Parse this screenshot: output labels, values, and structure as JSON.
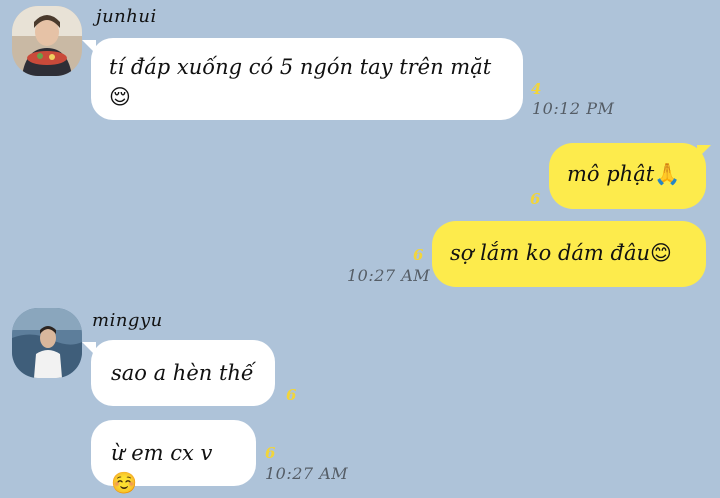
{
  "messages": [
    {
      "sender": "junhui",
      "text": "tí đáp xuống có 5 ngón tay trên mặt",
      "emoji": "😌",
      "unread": "4",
      "time": "10:12 PM"
    },
    {
      "sender": "me",
      "text": "mô phật",
      "emoji": "🙏",
      "unread": "6"
    },
    {
      "sender": "me",
      "text": "sợ lắm ko dám đâu",
      "emoji": "😊",
      "unread": "6",
      "time": "10:27 AM"
    },
    {
      "sender": "mingyu",
      "text": "sao a hèn thế",
      "unread": "6"
    },
    {
      "sender": "mingyu",
      "text": "ừ em cx v",
      "emoji": "☺️",
      "unread": "6",
      "time": "10:27 AM"
    }
  ],
  "colors": {
    "background": "#aec3d9",
    "incoming_bubble": "#ffffff",
    "outgoing_bubble": "#fdeb4c",
    "unread_count": "#f2d53a"
  }
}
